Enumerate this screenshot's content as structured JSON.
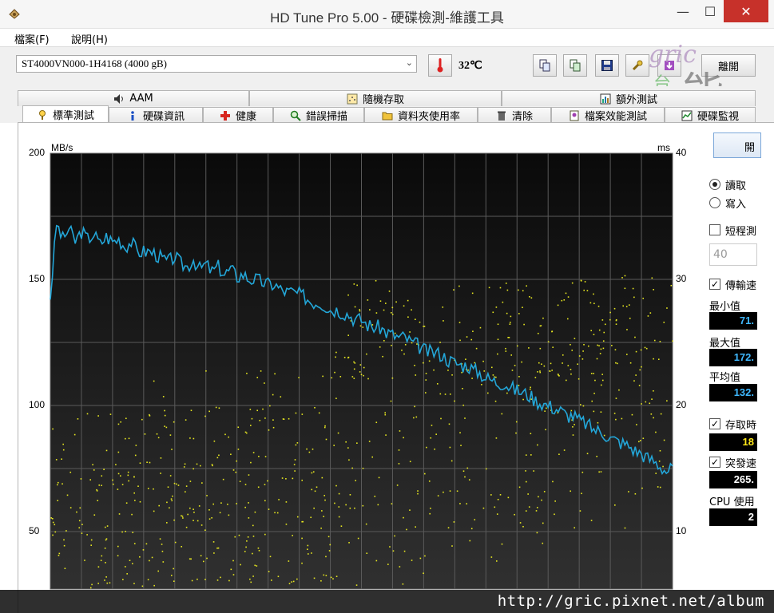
{
  "window": {
    "title": "HD Tune Pro  5.00 - 硬碟檢測-維護工具",
    "minimize_label": "—",
    "maximize_label": "☐",
    "close_label": "✕"
  },
  "menu": {
    "items": [
      "檔案(F)",
      "說明(H)"
    ]
  },
  "toolbar": {
    "drive": "ST4000VN000-1H4168 (4000 gB)",
    "temperature": "32℃",
    "exit_label": "離開"
  },
  "watermark": {
    "logo_text_main": "gric",
    "logo_text_side": "台灣",
    "logo_text_big": "能",
    "url": "http://gric.pixnet.net/album"
  },
  "tabs": {
    "top": [
      {
        "label": "AAM",
        "icon": "speaker-icon"
      },
      {
        "label": "隨機存取",
        "icon": "random-access-icon"
      },
      {
        "label": "額外測試",
        "icon": "extra-test-icon"
      }
    ],
    "bottom": [
      {
        "label": "標準測試",
        "icon": "benchmark-icon",
        "active": true
      },
      {
        "label": "硬碟資訊",
        "icon": "info-icon"
      },
      {
        "label": "健康",
        "icon": "health-cross-icon"
      },
      {
        "label": "錯誤掃描",
        "icon": "magnifier-icon"
      },
      {
        "label": "資料夾使用率",
        "icon": "folder-icon"
      },
      {
        "label": "清除",
        "icon": "trash-icon"
      },
      {
        "label": "檔案效能測試",
        "icon": "file-benchmark-icon"
      },
      {
        "label": "硬碟監視",
        "icon": "monitor-icon"
      }
    ]
  },
  "sidepanel": {
    "start_label": "開",
    "read_label": "讀取",
    "write_label": "寫入",
    "short_test_label": "短程測",
    "short_test_value": "40",
    "transfer_label": "傳輸速",
    "min_label": "最小值",
    "min_value": "71.",
    "max_label": "最大值",
    "max_value": "172.",
    "avg_label": "平均值",
    "avg_value": "132.",
    "access_label": "存取時",
    "access_value": "18",
    "burst_label": "突發速",
    "burst_value": "265.",
    "cpu_label": "CPU 使用",
    "cpu_value": "2"
  },
  "chart_data": {
    "type": "line",
    "left_unit": "MB/s",
    "right_unit": "ms",
    "left_ticks": [
      "200",
      "150",
      "100",
      "50"
    ],
    "right_ticks": [
      "40",
      "30",
      "20",
      "10"
    ],
    "ylim_left": [
      0,
      200
    ],
    "ylim_right": [
      0,
      40
    ],
    "xlim": [
      0,
      100
    ],
    "grid": true,
    "colors": {
      "transfer": "#23a6d8",
      "access": "#e8e820",
      "background_top": "#0a0a0a",
      "background_bottom": "#303030",
      "grid": "#5a5a5a"
    },
    "series": [
      {
        "name": "transfer",
        "x": [
          0,
          1,
          2,
          3,
          4,
          5,
          6,
          7,
          8,
          9,
          10,
          11,
          12,
          13,
          14,
          15,
          16,
          17,
          18,
          19,
          20,
          21,
          22,
          23,
          24,
          25,
          26,
          27,
          28,
          29,
          30,
          31,
          32,
          33,
          34,
          35,
          36,
          37,
          38,
          39,
          40,
          41,
          42,
          43,
          44,
          45,
          46,
          47,
          48,
          49,
          50,
          51,
          52,
          53,
          54,
          55,
          56,
          57,
          58,
          59,
          60,
          61,
          62,
          63,
          64,
          65,
          66,
          67,
          68,
          69,
          70,
          71,
          72,
          73,
          74,
          75,
          76,
          77,
          78,
          79,
          80,
          81,
          82,
          83,
          84,
          85,
          86,
          87,
          88,
          89,
          90,
          91,
          92,
          93,
          94,
          95,
          96,
          97,
          98,
          99,
          100
        ],
        "values": [
          143,
          172,
          166,
          170,
          165,
          169,
          166,
          168,
          164,
          167,
          165,
          166,
          163,
          165,
          161,
          161,
          161,
          160,
          158,
          157,
          159,
          156,
          155,
          158,
          154,
          156,
          153,
          155,
          152,
          154,
          151,
          152,
          150,
          150,
          149,
          148,
          148,
          146,
          145,
          145,
          144,
          143,
          141,
          141,
          140,
          138,
          138,
          137,
          136,
          134,
          134,
          132,
          131,
          131,
          129,
          128,
          127,
          127,
          125,
          124,
          122,
          121,
          121,
          120,
          118,
          117,
          116,
          116,
          114,
          113,
          111,
          110,
          109,
          109,
          107,
          106,
          105,
          104,
          102,
          101,
          100,
          99,
          98,
          96,
          96,
          94,
          93,
          91,
          90,
          89,
          87,
          86,
          85,
          84,
          82,
          81,
          79,
          78,
          76,
          74,
          75
        ]
      }
    ]
  }
}
